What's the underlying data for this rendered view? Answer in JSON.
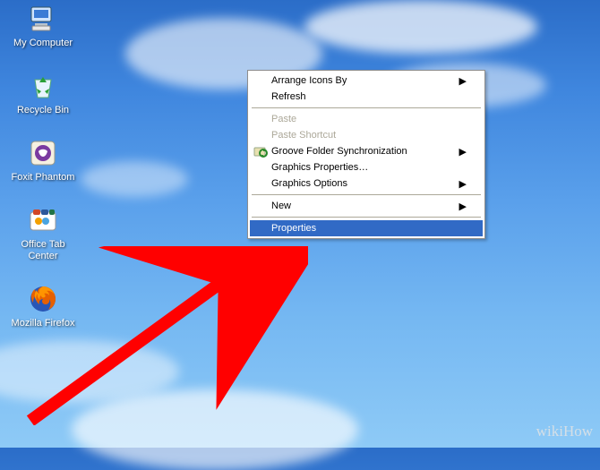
{
  "icons": [
    {
      "label": "My Computer",
      "glyph": "my_computer"
    },
    {
      "label": "Recycle Bin",
      "glyph": "recycle_bin"
    },
    {
      "label": "Foxit Phantom",
      "glyph": "foxit"
    },
    {
      "label": "Office Tab\nCenter",
      "glyph": "officetab"
    },
    {
      "label": "Mozilla Firefox",
      "glyph": "firefox"
    }
  ],
  "menu": {
    "arrange": "Arrange Icons By",
    "refresh": "Refresh",
    "paste": "Paste",
    "paste_sc": "Paste Shortcut",
    "groove": "Groove Folder Synchronization",
    "gprops": "Graphics Properties…",
    "gopts": "Graphics Options",
    "new": "New",
    "properties": "Properties"
  },
  "watermark": "wikiHow",
  "colors": {
    "highlight": "#316ac5",
    "arrow": "#ff0000"
  }
}
